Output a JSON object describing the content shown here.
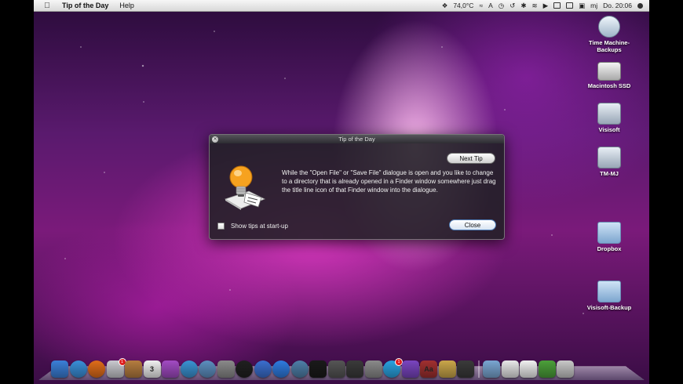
{
  "menubar": {
    "app_name": "Tip of the Day",
    "menus": [
      "Help"
    ],
    "temperature": "74,0°C",
    "user": "mj",
    "clock": "Do. 20:06",
    "icons": [
      "dropbox-icon",
      "temperature-icon",
      "script-icon",
      "font-icon",
      "clock-icon",
      "timemachine-icon",
      "bluetooth-icon",
      "wifi-icon",
      "volume-icon",
      "battery-icon",
      "keyboard-icon",
      "lock-icon",
      "spotlight-icon"
    ]
  },
  "desktop": {
    "icons": [
      {
        "label": "Time Machine-Backups",
        "kind": "timemachine"
      },
      {
        "label": "Macintosh SSD",
        "kind": "disk"
      },
      {
        "label": "Visisoft",
        "kind": "network-disk"
      },
      {
        "label": "TM-MJ",
        "kind": "network-disk"
      },
      {
        "label": "Dropbox",
        "kind": "folder"
      },
      {
        "label": "Visisoft-Backup",
        "kind": "folder"
      }
    ]
  },
  "dialog": {
    "title": "Tip of the Day",
    "next_tip_label": "Next Tip",
    "tip_text": "While the \"Open File\" or \"Save File\" dialogue is open and you like to change to a directory that is already opened in a Finder window somewhere just drag the title line icon of that Finder window into the dialogue.",
    "show_tips_label": "Show tips at start-up",
    "show_tips_checked": false,
    "close_label": "Close"
  },
  "dock": {
    "apps": [
      {
        "name": "finder",
        "color": "#3b7fd8"
      },
      {
        "name": "safari",
        "color": "#3a8fd8"
      },
      {
        "name": "firefox",
        "color": "#e06d1a"
      },
      {
        "name": "mail",
        "color": "#c9c9cf",
        "badge": "1"
      },
      {
        "name": "address-book",
        "color": "#b57d40"
      },
      {
        "name": "ical",
        "color": "#f0f0f0",
        "text": "3"
      },
      {
        "name": "notes",
        "color": "#a24bc3"
      },
      {
        "name": "fluid",
        "color": "#3b93d3"
      },
      {
        "name": "network-utility",
        "color": "#5d8fc0"
      },
      {
        "name": "photos",
        "color": "#8a8a8a"
      },
      {
        "name": "camera",
        "color": "#202020"
      },
      {
        "name": "itunes",
        "color": "#3b6fcf"
      },
      {
        "name": "app-store",
        "color": "#2f7be0"
      },
      {
        "name": "time-machine",
        "color": "#4f7fa8"
      },
      {
        "name": "terminal",
        "color": "#1a1a1a"
      },
      {
        "name": "activity-monitor",
        "color": "#555555"
      },
      {
        "name": "expose",
        "color": "#3a3a3a"
      },
      {
        "name": "system-preferences",
        "color": "#8a8a8a"
      },
      {
        "name": "twitter",
        "color": "#2aa2e0",
        "badge": "1"
      },
      {
        "name": "quicksilver",
        "color": "#7a45c0"
      },
      {
        "name": "dictionary",
        "color": "#a03030",
        "text": "Aa"
      },
      {
        "name": "textedit",
        "color": "#caa64a"
      },
      {
        "name": "tip-of-the-day",
        "color": "#3a3a3a"
      }
    ],
    "stacks": [
      {
        "name": "applications-folder",
        "color": "#7aa6d2"
      },
      {
        "name": "documents-stack",
        "color": "#e8e8e8"
      },
      {
        "name": "downloads-stack",
        "color": "#f0f0f0"
      },
      {
        "name": "android-stack",
        "color": "#4ca03a"
      },
      {
        "name": "trash",
        "color": "#c8c8c8"
      }
    ]
  }
}
